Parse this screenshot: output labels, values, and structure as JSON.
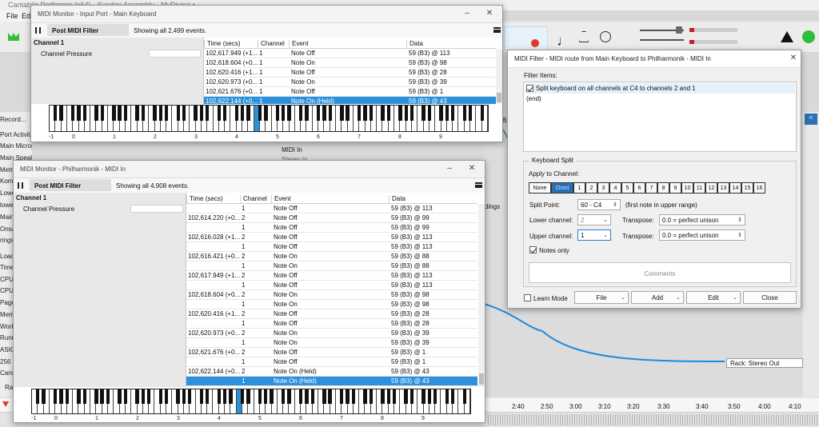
{
  "app": {
    "title": "Cantabile Performer (x64) - Sunday Assembly - MyDivine •",
    "menu": [
      "File",
      "Edit"
    ],
    "left_labels": [
      "Record...",
      "Port Activit",
      "Main Micropho...",
      "Main Speakers:",
      "Metr",
      "Kom",
      "Lowe",
      "lowe",
      "Main",
      "Onsa",
      "rings",
      "Load",
      "Time",
      "CPU",
      "CPU",
      "Page",
      "Mem",
      "Work",
      "Runn",
      "ASIO",
      "256 s",
      "Cans",
      "Ra"
    ],
    "bg_texts": [
      "Bindi",
      "MIDI In",
      "Stereo In",
      "dings",
      "Rack: Stereo Out"
    ],
    "timeline": [
      "2:40",
      "2:50",
      "3:00",
      "3:10",
      "3:20",
      "3:30",
      "3:40",
      "3:50",
      "4:00",
      "4:10"
    ]
  },
  "mon1": {
    "title": "MIDI Monitor - Input Port - Main Keyboard",
    "filter_label": "Post MIDI Filter",
    "status": "Showing all 2,499 events.",
    "channel": "Channel 1",
    "pressure": "Channel Pressure",
    "cols": [
      "Time (secs)",
      "Channel",
      "Event",
      "Data"
    ],
    "rows": [
      [
        "102,617.949 (+1...",
        "1",
        "Note Off",
        "59 (B3) @ 113"
      ],
      [
        "102,618.604 (+0...",
        "1",
        "Note On",
        "59 (B3) @ 98"
      ],
      [
        "102,620.416 (+1...",
        "1",
        "Note Off",
        "59 (B3) @ 28"
      ],
      [
        "102,620.973 (+0...",
        "1",
        "Note On",
        "59 (B3) @ 39"
      ],
      [
        "102,621.676 (+0...",
        "1",
        "Note Off",
        "59 (B3) @ 1"
      ],
      [
        "102,622.144 (+0...",
        "1",
        "Note On (Held)",
        "59 (B3) @ 43"
      ]
    ],
    "selected_row": 5,
    "ruler": [
      "-1",
      "0",
      "1",
      "2",
      "3",
      "4",
      "5",
      "6",
      "7",
      "8",
      "9"
    ]
  },
  "mon2": {
    "title": "MIDI Monitor - Philharmonik - MIDI In",
    "filter_label": "Post MIDI Filter",
    "status": "Showing all 4,908 events.",
    "channel": "Channel 1",
    "pressure": "Channel Pressure",
    "cols": [
      "Time (secs)",
      "Channel",
      "Event",
      "Data"
    ],
    "rows": [
      [
        "",
        "1",
        "Note Off",
        "59 (B3) @ 113"
      ],
      [
        "102,614.220 (+0...",
        "2",
        "Note Off",
        "59 (B3) @ 99"
      ],
      [
        "",
        "1",
        "Note Off",
        "59 (B3) @ 99"
      ],
      [
        "102,616.028 (+1...",
        "2",
        "Note Off",
        "59 (B3) @ 113"
      ],
      [
        "",
        "1",
        "Note Off",
        "59 (B3) @ 113"
      ],
      [
        "102,616.421 (+0...",
        "2",
        "Note On",
        "59 (B3) @ 88"
      ],
      [
        "",
        "1",
        "Note On",
        "59 (B3) @ 88"
      ],
      [
        "102,617.949 (+1...",
        "2",
        "Note Off",
        "59 (B3) @ 113"
      ],
      [
        "",
        "1",
        "Note Off",
        "59 (B3) @ 113"
      ],
      [
        "102,618.604 (+0...",
        "2",
        "Note On",
        "59 (B3) @ 98"
      ],
      [
        "",
        "1",
        "Note On",
        "59 (B3) @ 98"
      ],
      [
        "102,620.416 (+1...",
        "2",
        "Note Off",
        "59 (B3) @ 28"
      ],
      [
        "",
        "1",
        "Note Off",
        "59 (B3) @ 28"
      ],
      [
        "102,620.973 (+0...",
        "2",
        "Note On",
        "59 (B3) @ 39"
      ],
      [
        "",
        "1",
        "Note On",
        "59 (B3) @ 39"
      ],
      [
        "102,621.676 (+0...",
        "2",
        "Note Off",
        "59 (B3) @ 1"
      ],
      [
        "",
        "1",
        "Note Off",
        "59 (B3) @ 1"
      ],
      [
        "102,622.144 (+0...",
        "2",
        "Note On (Held)",
        "59 (B3) @ 43"
      ],
      [
        "",
        "1",
        "Note On (Held)",
        "59 (B3) @ 43"
      ]
    ],
    "selected_row": 18,
    "ruler": [
      "-1",
      "0",
      "1",
      "2",
      "3",
      "4",
      "5",
      "6",
      "7",
      "8",
      "9"
    ]
  },
  "filter": {
    "title": "MIDI Filter - MIDI route from Main Keyboard to Philharmonik - MIDI In",
    "items_label": "Filter Items:",
    "items": [
      "Split keyboard on all channels at C4 to channels 2 and 1",
      "(end)"
    ],
    "split_group": "Keyboard Split",
    "apply_label": "Apply to Channel:",
    "channels": [
      "None",
      "Omni",
      "1",
      "2",
      "3",
      "4",
      "5",
      "6",
      "7",
      "8",
      "9",
      "10",
      "11",
      "12",
      "13",
      "14",
      "15",
      "16"
    ],
    "active_channel": 1,
    "split_point_label": "Split Point:",
    "split_point": "60 - C4",
    "split_hint": "(first note in upper range)",
    "lower_label": "Lower channel:",
    "lower_value": "2",
    "upper_label": "Upper channel:",
    "upper_value": "1",
    "transpose_label": "Transpose:",
    "transpose_lower": "0.0 = perfect unison",
    "transpose_upper": "0.0 = perfect unison",
    "notes_only": "Notes only",
    "comments_placeholder": "Comments",
    "learn_mode": "Learn Mode",
    "buttons": {
      "file": "File",
      "add": "Add",
      "edit": "Edit",
      "close": "Close"
    }
  },
  "colors": {
    "selection": "#2b91dd",
    "active_channel": "#2a6fb5",
    "route_line": "#1c8be0"
  }
}
